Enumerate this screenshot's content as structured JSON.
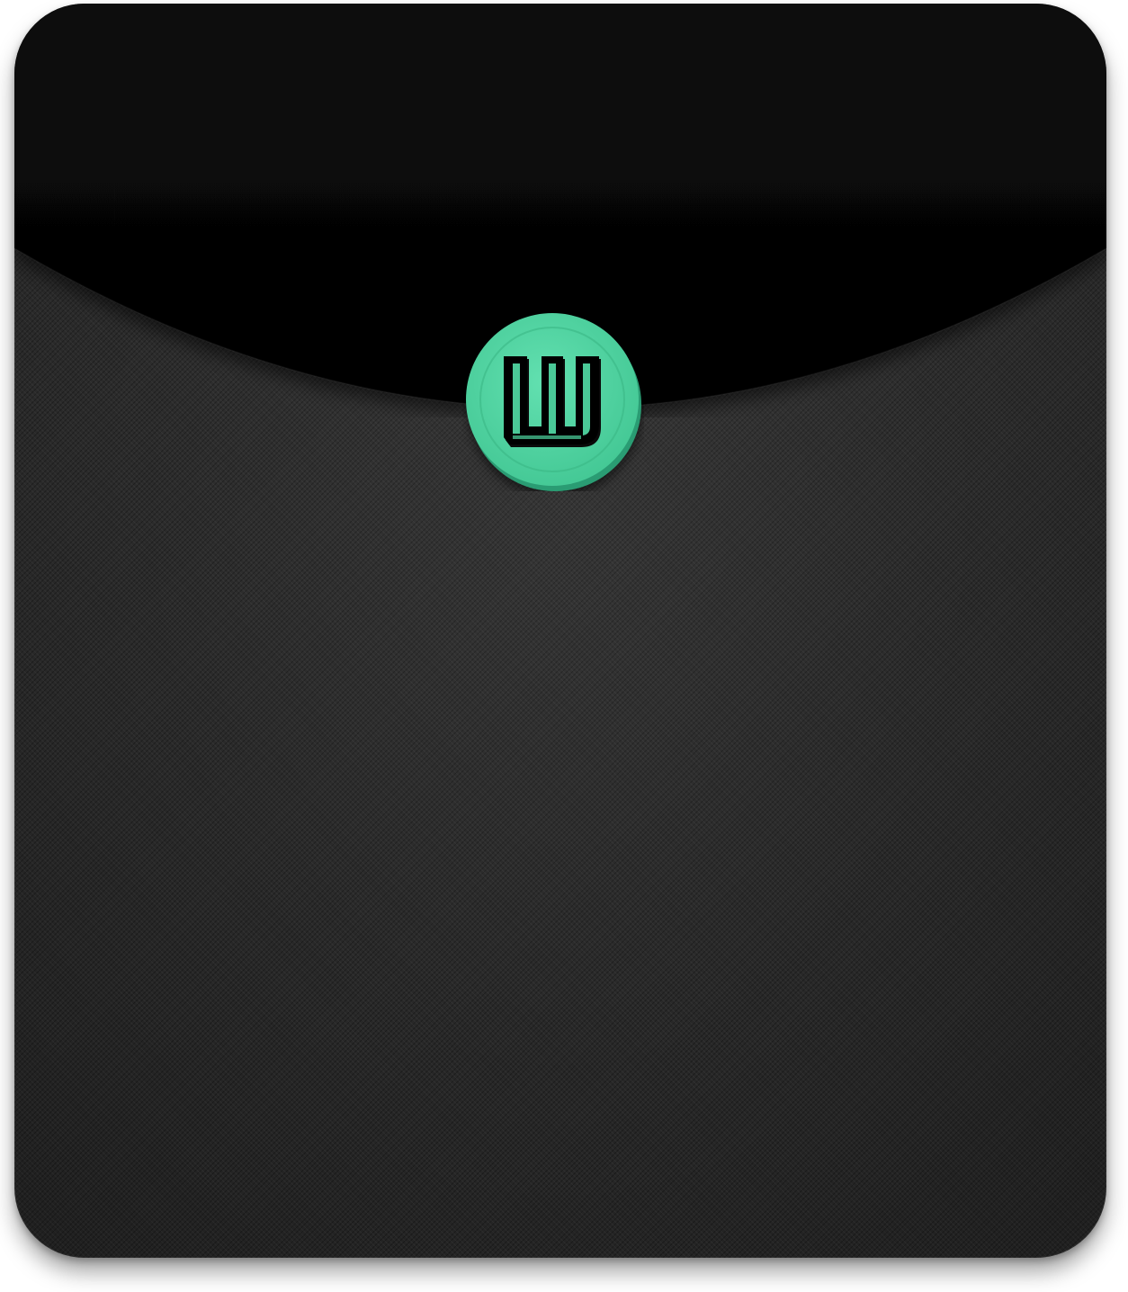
{
  "product": {
    "name": "tablet sleeve",
    "body_color": "#2b2b2b",
    "flap_color": "#050505"
  },
  "logo": {
    "letter": "W",
    "badge_color": "#4fd4a0",
    "badge_edge_color": "#2fae80",
    "glyph_color": "#000000",
    "icon": "w-logo-icon"
  }
}
